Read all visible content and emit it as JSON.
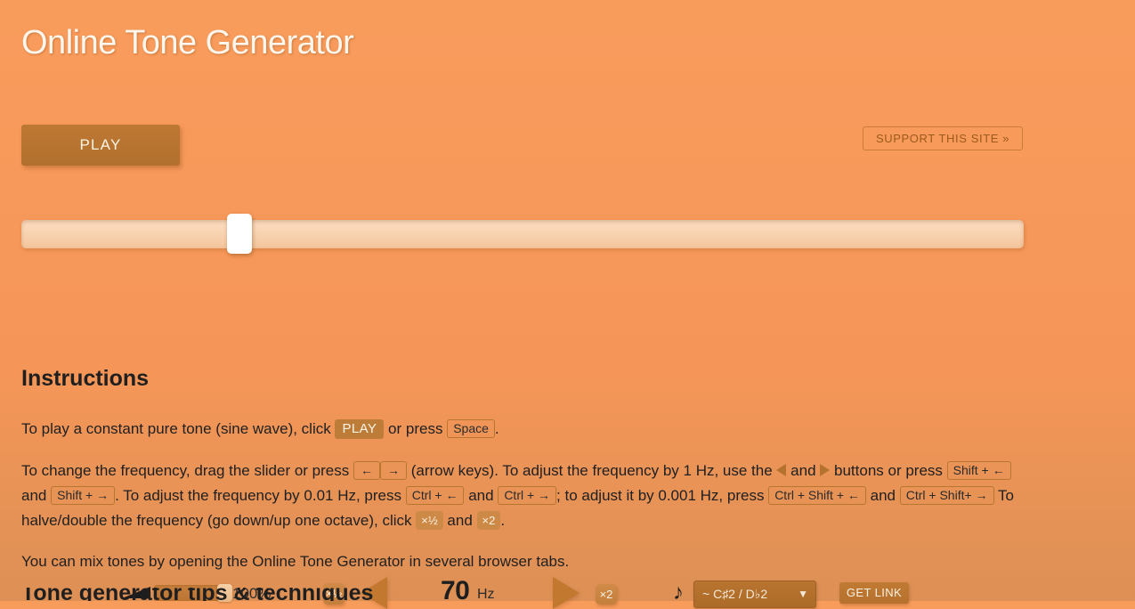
{
  "app": {
    "title": "Online Tone Generator",
    "background_color": "#f89c5c",
    "accent_color": "#b5712f"
  },
  "controls": {
    "play_label": "PLAY",
    "support_label": "SUPPORT THIS SITE »",
    "get_link_label": "GET LINK",
    "halve_label": "×½",
    "double_label": "×2",
    "volume_percent": "100%",
    "frequency_value": "70",
    "frequency_unit": "Hz",
    "note_icon": "♪",
    "note_selected": "~ C♯2 / D♭2",
    "note_caret": "▼",
    "prev_arrow": "◀",
    "next_arrow": "▶"
  },
  "instructions": {
    "heading": "Instructions",
    "p1": {
      "a": "To play a constant pure tone (sine wave), click",
      "play_badge": "PLAY",
      "b": "or press",
      "space_key": "Space",
      "c": "."
    },
    "p2": {
      "a": "To change the frequency, drag the slider or press",
      "left_key": "←",
      "right_key": "→",
      "b": "(arrow keys). To adjust the frequency by 1 Hz, use the",
      "c": "and",
      "d": "buttons or press",
      "shift_left": "Shift + ←",
      "e": "and",
      "shift_right": "Shift + →",
      "f": ". To adjust the frequency by 0.01 Hz, press",
      "ctrl_left": "Ctrl + ←",
      "g": "and",
      "ctrl_right": "Ctrl + →",
      "h": "; to adjust it by 0.001 Hz, press",
      "ctrl_shift_left": "Ctrl + Shift + ←",
      "i": "and",
      "ctrl_shift_right": "Ctrl + Shift+ →",
      "j": "To halve/double the frequency (go down/up one octave), click",
      "halve_badge": "×½",
      "k": "and",
      "double_badge": "×2",
      "l": "."
    },
    "p3": "You can mix tones by opening the Online Tone Generator in several browser tabs."
  },
  "bottom": {
    "next_heading": "Tone generator tips & techniques"
  }
}
